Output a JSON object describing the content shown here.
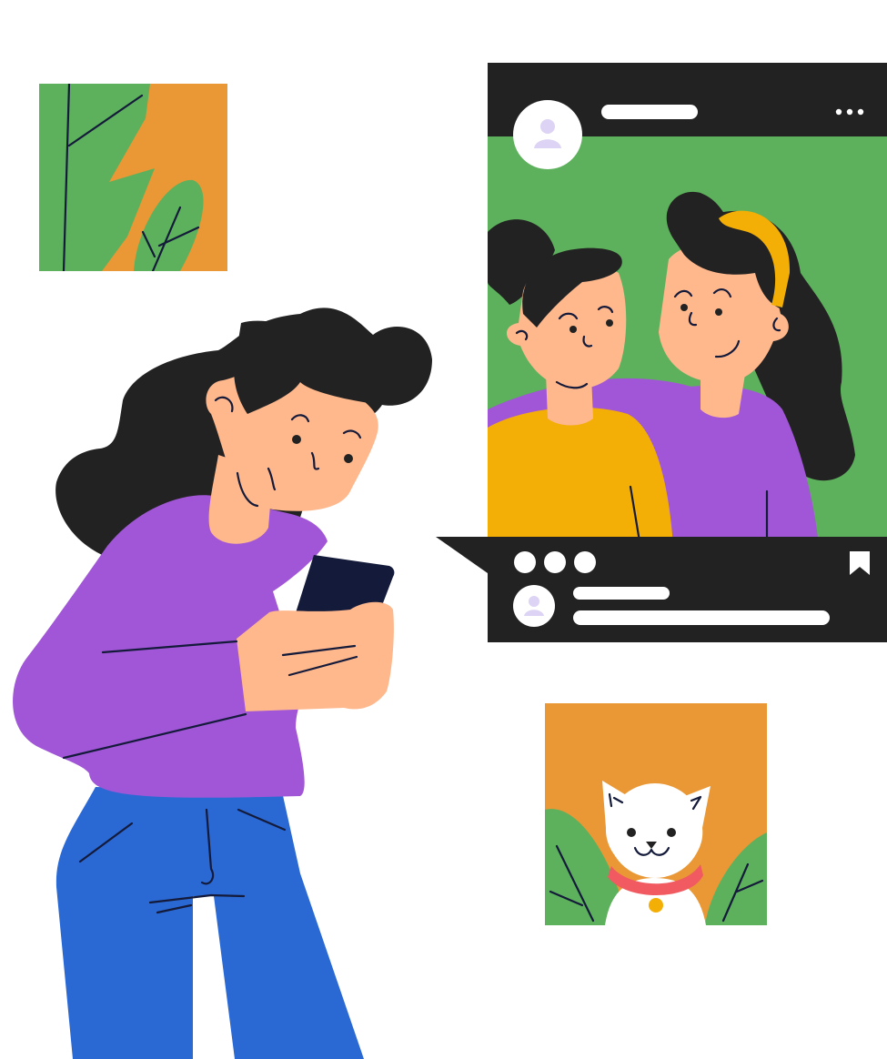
{
  "colors": {
    "background": "#ffffff",
    "leaf_green": "#5db15c",
    "orange": "#e99835",
    "dark": "#222222",
    "purple": "#a056d6",
    "skin": "#ffb78c",
    "yellow": "#f4af06",
    "blue": "#2a69d4",
    "phone": "#141a3a",
    "avatar_lilac": "#ddd3f4",
    "collar_red": "#f05a60",
    "bell_gold": "#f4af06"
  },
  "post": {
    "header_icons": [
      "avatar-icon",
      "more-options-icon"
    ],
    "footer_icons": [
      "reaction-dots-icon",
      "bookmark-icon",
      "commenter-avatar-icon"
    ]
  },
  "icons": [
    "leaf-picture-icon",
    "cat-picture-icon",
    "phone-icon"
  ]
}
